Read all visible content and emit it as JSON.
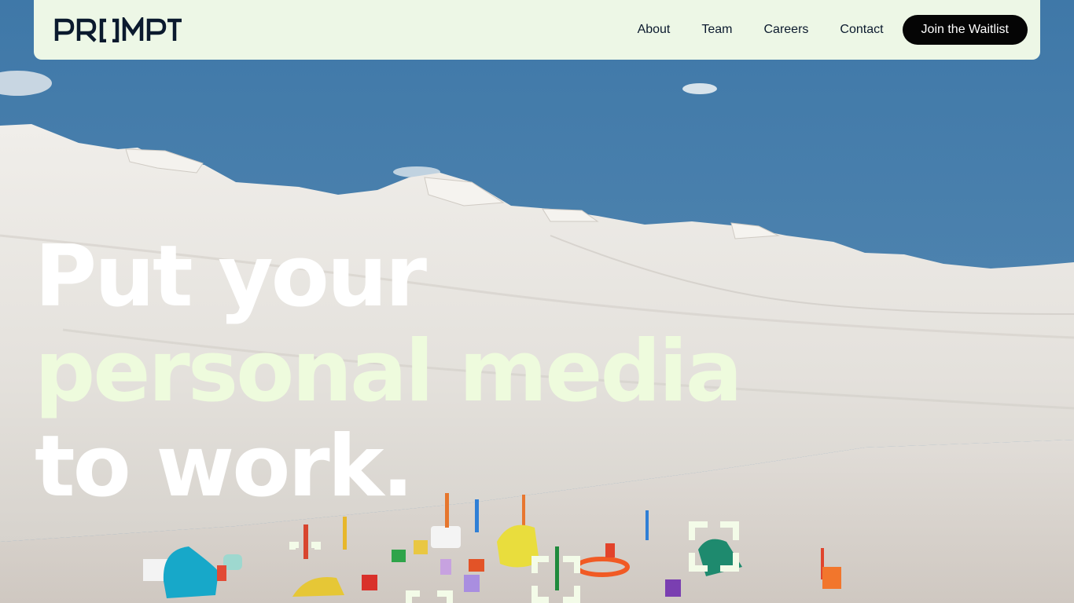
{
  "brand": {
    "name": "PROMPT"
  },
  "nav": {
    "links": [
      "About",
      "Team",
      "Careers",
      "Contact"
    ],
    "cta_label": "Join the Waitlist"
  },
  "hero": {
    "line1": "Put your",
    "line2": "personal media",
    "line3": "to work."
  },
  "colors": {
    "nav_background": "#edf7e6",
    "nav_text": "#0b1a2e",
    "cta_background": "#050505",
    "cta_text": "#ffffff",
    "headline_primary": "#ffffff",
    "headline_accent": "#eefbdd",
    "sky": "#4a7fab",
    "salt": "#e6e3de"
  }
}
